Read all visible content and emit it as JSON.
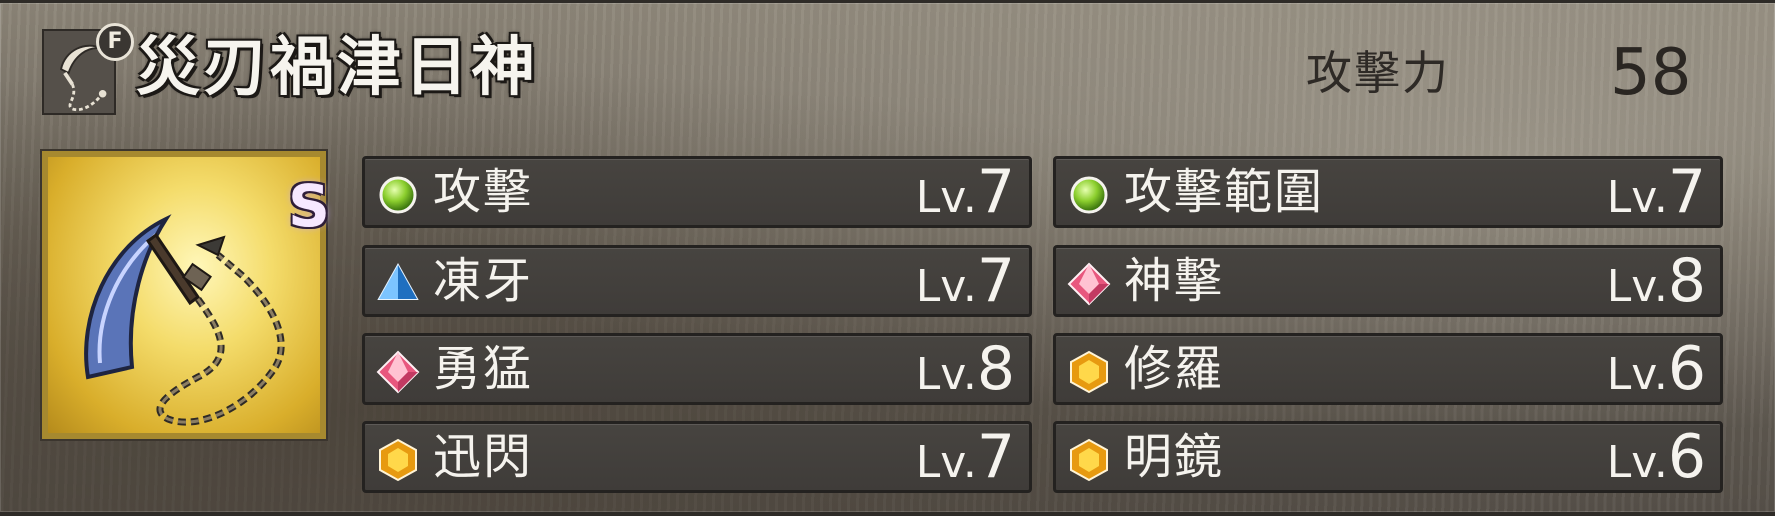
{
  "weapon": {
    "name": "災刃禍津日神",
    "type_icon": "sickle-chain-icon",
    "favorite_badge": "F",
    "rank": "S",
    "image": "kusarigama-weapon-image"
  },
  "stats": {
    "attack_label": "攻擊力",
    "attack_value": "58"
  },
  "skills": [
    {
      "name": "攻擊",
      "level_prefix": "Lv.",
      "level": "7",
      "gem": "green-orb-icon",
      "color": "#7cc22d"
    },
    {
      "name": "攻擊範圍",
      "level_prefix": "Lv.",
      "level": "7",
      "gem": "green-orb-icon",
      "color": "#7cc22d"
    },
    {
      "name": "凍牙",
      "level_prefix": "Lv.",
      "level": "7",
      "gem": "blue-pyramid-icon",
      "color": "#3aa0e6"
    },
    {
      "name": "神擊",
      "level_prefix": "Lv.",
      "level": "8",
      "gem": "pink-diamond-icon",
      "color": "#e66a8c"
    },
    {
      "name": "勇猛",
      "level_prefix": "Lv.",
      "level": "8",
      "gem": "pink-diamond-icon",
      "color": "#e66a8c"
    },
    {
      "name": "修羅",
      "level_prefix": "Lv.",
      "level": "6",
      "gem": "amber-hexagon-icon",
      "color": "#f0b21a"
    },
    {
      "name": "迅閃",
      "level_prefix": "Lv.",
      "level": "7",
      "gem": "amber-hexagon-icon",
      "color": "#f0b21a"
    },
    {
      "name": "明鏡",
      "level_prefix": "Lv.",
      "level": "6",
      "gem": "amber-hexagon-icon",
      "color": "#f0b21a"
    }
  ]
}
